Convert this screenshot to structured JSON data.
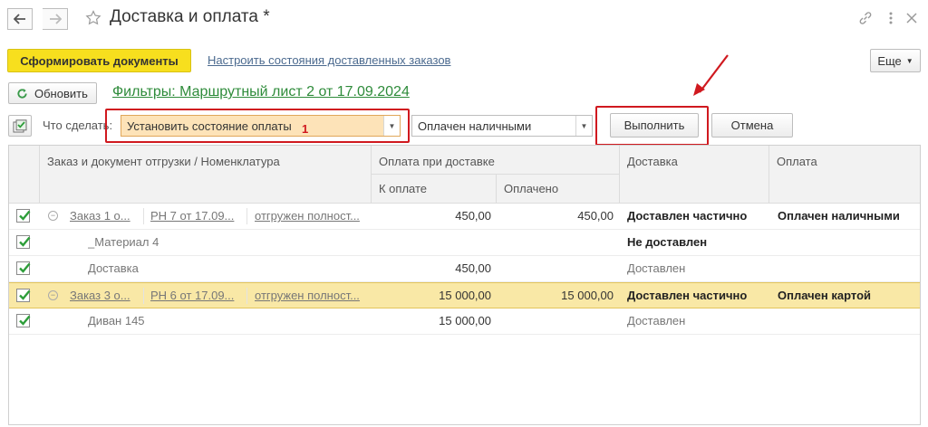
{
  "window": {
    "title": "Доставка и оплата *"
  },
  "toolbar": {
    "generate_label": "Сформировать документы",
    "configure_link": "Настроить состояния доставленных заказов",
    "more_label": "Еще",
    "refresh_label": "Обновить",
    "filters_link": "Фильтры: Маршрутный лист 2 от 17.09.2024"
  },
  "action": {
    "what_label": "Что сделать:",
    "action_value": "Установить состояние оплаты",
    "annotation": "1",
    "payment_value": "Оплачен наличными",
    "execute_label": "Выполнить",
    "cancel_label": "Отмена"
  },
  "table": {
    "headers": {
      "order": "Заказ и документ отгрузки / Номенклатура",
      "payment_group": "Оплата при доставке",
      "to_pay": "К оплате",
      "paid": "Оплачено",
      "delivery": "Доставка",
      "payment": "Оплата"
    },
    "rows": [
      {
        "order": "Заказ 1 о...",
        "doc": "РН 7 от 17.09...",
        "shipment": "отгружен полност...",
        "name": "",
        "to_pay": "450,00",
        "paid": "450,00",
        "delivery": "Доставлен частично",
        "payment": "Оплачен наличными"
      },
      {
        "order": "",
        "doc": "",
        "shipment": "",
        "name": "_Материал 4",
        "to_pay": "",
        "paid": "",
        "delivery": "Не доставлен",
        "payment": ""
      },
      {
        "order": "",
        "doc": "",
        "shipment": "",
        "name": "Доставка",
        "to_pay": "450,00",
        "paid": "",
        "delivery": "Доставлен",
        "payment": ""
      },
      {
        "order": "Заказ 3 о...",
        "doc": "РН 6 от 17.09...",
        "shipment": "отгружен полност...",
        "name": "",
        "to_pay": "15 000,00",
        "paid": "15 000,00",
        "delivery": "Доставлен частично",
        "payment": "Оплачен картой"
      },
      {
        "order": "",
        "doc": "",
        "shipment": "",
        "name": "Диван 145",
        "to_pay": "15 000,00",
        "paid": "",
        "delivery": "Доставлен",
        "payment": ""
      }
    ]
  },
  "colors": {
    "accent_yellow": "#f7df1e",
    "selected_row": "#f9e8a6",
    "highlight_red": "#d0191f",
    "checkbox_green": "#2e9e3a"
  }
}
